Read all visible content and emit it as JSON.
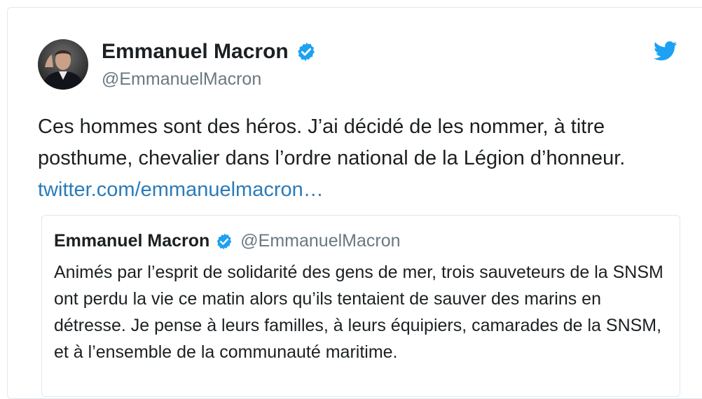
{
  "tweet": {
    "author_name": "Emmanuel Macron",
    "author_handle": "@EmmanuelMacron",
    "text": "Ces hommes sont des héros. J’ai décidé de les nommer, à titre posthume, chevalier dans l’ordre national de la Légion d’honneur. ",
    "link_text": "twitter.com/emmanuelmacron…",
    "verified_icon": "verified-badge-icon",
    "platform_icon": "twitter-bird-icon"
  },
  "quoted_tweet": {
    "author_name": "Emmanuel Macron",
    "author_handle": "@EmmanuelMacron",
    "text": "Animés par l’esprit de solidarité des gens de mer, trois sauveteurs de la SNSM ont perdu la vie ce matin alors qu’ils tentaient de sauver des marins en détresse. Je pense à leurs familles, à leurs équipiers, camarades de la SNSM, et à l’ensemble de la communauté maritime."
  },
  "colors": {
    "verified_blue": "#1da1f2",
    "link_blue": "#2b7bb9",
    "handle_gray": "#697882",
    "border": "#e1e8ed"
  }
}
